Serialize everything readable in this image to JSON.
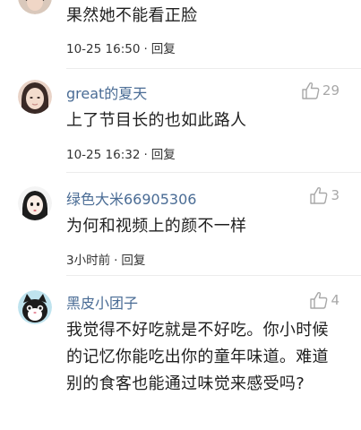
{
  "comments": [
    {
      "text": "果然她不能看正脸",
      "time": "10-25 16:50",
      "dot": "·",
      "reply": "回复"
    },
    {
      "username": "great的夏天",
      "likes": "29",
      "text": "上了节目长的也如此路人",
      "time": "10-25 16:32",
      "dot": "·",
      "reply": "回复"
    },
    {
      "username": "绿色大米66905306",
      "likes": "3",
      "text": "为何和视频上的颜不一样",
      "time": "3小时前",
      "dot": "·",
      "reply": "回复"
    },
    {
      "username": "黑皮小团子",
      "likes": "4",
      "text": "我觉得不好吃就是不好吃。你小时候的记忆你能吃出你的童年味道。难道别的食客也能通过味觉来感受吗?"
    }
  ],
  "colors": {
    "username": "#4a6c95",
    "like": "#a8a8a8",
    "text": "#1f1f1f",
    "divider": "#ececec"
  },
  "icons": {
    "like": "thumbs-up-icon"
  }
}
